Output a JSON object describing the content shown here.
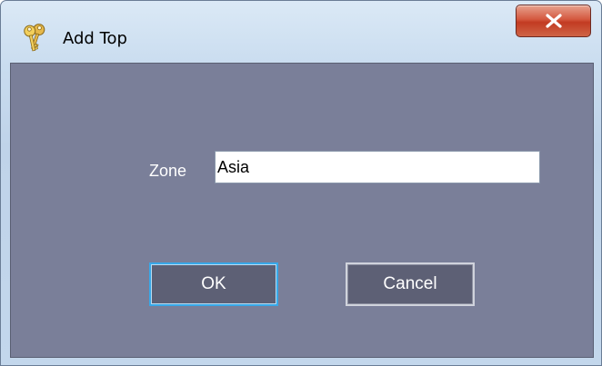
{
  "window": {
    "title": "Add Top",
    "app_icon": "keys-icon",
    "close_icon": "close-icon"
  },
  "form": {
    "zone_label": "Zone",
    "zone_value": "Asia"
  },
  "buttons": {
    "ok_label": "OK",
    "cancel_label": "Cancel"
  },
  "colors": {
    "client_background": "#7a7f99",
    "button_background": "#5d6075",
    "focus_border": "#38a8e8",
    "close_button": "#c23b22"
  }
}
